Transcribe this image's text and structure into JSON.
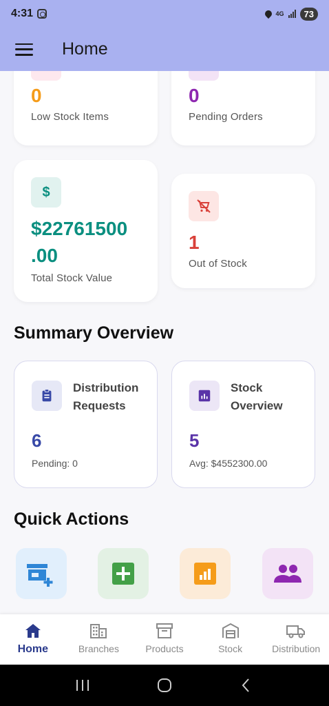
{
  "status": {
    "time": "4:31",
    "network": "4G",
    "battery": "73"
  },
  "appbar": {
    "title": "Home"
  },
  "stats": {
    "low_stock": {
      "value": "0",
      "label": "Low Stock Items"
    },
    "pending_orders": {
      "value": "0",
      "label": "Pending Orders"
    },
    "total_value": {
      "value_line1": "$22761500",
      "value_line2": ".00",
      "label": "Total Stock Value",
      "icon_text": "$"
    },
    "out_of_stock": {
      "value": "1",
      "label": "Out of Stock"
    }
  },
  "summary": {
    "title": "Summary Overview",
    "distribution": {
      "title": "Distribution Requests",
      "value": "6",
      "sub": "Pending: 0"
    },
    "stock": {
      "title": "Stock Overview",
      "value": "5",
      "sub": "Avg: $4552300.00"
    }
  },
  "quick_actions": {
    "title": "Quick Actions",
    "items": [
      "add-store-icon",
      "add-product-icon",
      "report-icon",
      "users-icon"
    ]
  },
  "nav": {
    "items": [
      {
        "label": "Home",
        "icon": "home-icon",
        "active": true
      },
      {
        "label": "Branches",
        "icon": "building-icon"
      },
      {
        "label": "Products",
        "icon": "archive-icon"
      },
      {
        "label": "Stock",
        "icon": "warehouse-icon"
      },
      {
        "label": "Distribution",
        "icon": "truck-icon"
      }
    ]
  },
  "colors": {
    "appbar": "#a9b1f0",
    "orange": "#f59c1a",
    "purple": "#8e27b0",
    "teal": "#0b8f80",
    "red": "#d9413a",
    "indigo": "#3849a7",
    "deep_purple": "#5a34a8"
  }
}
